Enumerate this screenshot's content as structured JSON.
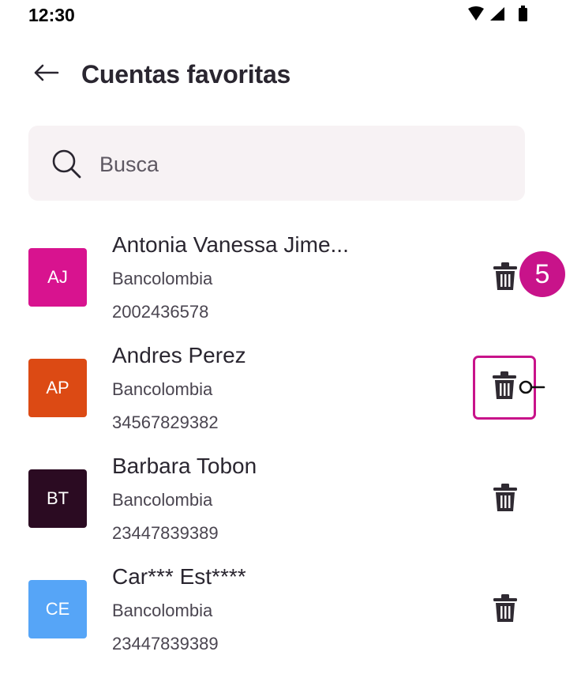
{
  "status_bar": {
    "time": "12:30",
    "icons": [
      "wifi-icon",
      "signal-icon",
      "battery-icon"
    ]
  },
  "header": {
    "back_icon": "arrow-left-icon",
    "title": "Cuentas favoritas"
  },
  "search": {
    "placeholder": "Busca",
    "value": "",
    "icon": "search-icon"
  },
  "accounts": [
    {
      "initials": "AJ",
      "name": "Antonia Vanessa Jime...",
      "bank": "Bancolombia",
      "number": "2002436578",
      "avatar_color": "#d8138f"
    },
    {
      "initials": "AP",
      "name": "Andres Perez",
      "bank": "Bancolombia",
      "number": "34567829382",
      "avatar_color": "#dc4a14"
    },
    {
      "initials": "BT",
      "name": "Barbara Tobon",
      "bank": "Bancolombia",
      "number": "23447839389",
      "avatar_color": "#2b0b22"
    },
    {
      "initials": "CE",
      "name": "Car*** Est****",
      "bank": "Bancolombia",
      "number": "23447839389",
      "avatar_color": "#56a5f7"
    }
  ],
  "delete_icon": "trash-icon",
  "annotation": {
    "step_number": "5",
    "accent_color": "#c8138a"
  }
}
